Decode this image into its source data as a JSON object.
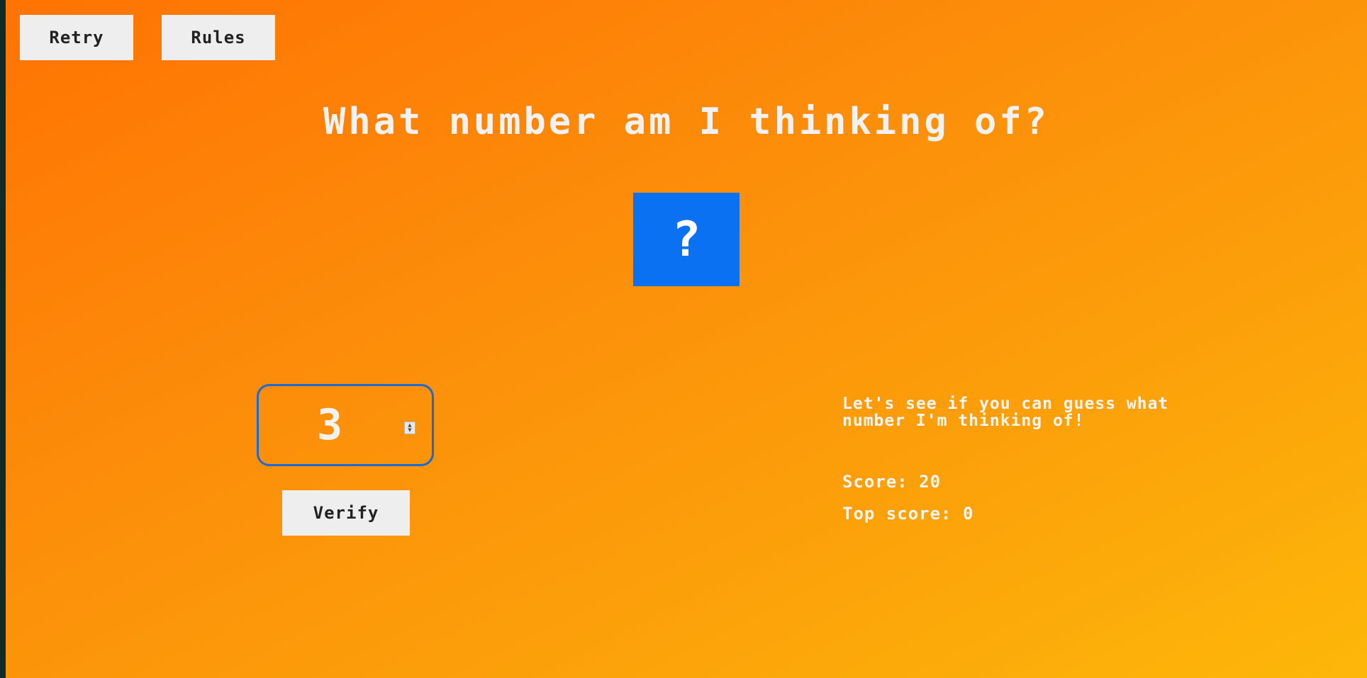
{
  "buttons": {
    "retry": "Retry",
    "rules": "Rules",
    "verify": "Verify"
  },
  "title": "What number am I thinking of?",
  "mystery": {
    "symbol": "?",
    "color": "#0a71f2"
  },
  "guess": {
    "value": "3",
    "spinner_icon": "spinner-arrows-icon"
  },
  "message": "Let's see if you can guess what number I'm thinking of!",
  "score": {
    "label": "Score:",
    "value": "20"
  },
  "top_score": {
    "label": "Top score:",
    "value": "0"
  },
  "colors": {
    "background_start": "#ff7303",
    "background_end": "#fdb709",
    "accent_border": "#1c6ad4",
    "button_bg": "#eeeeee"
  }
}
